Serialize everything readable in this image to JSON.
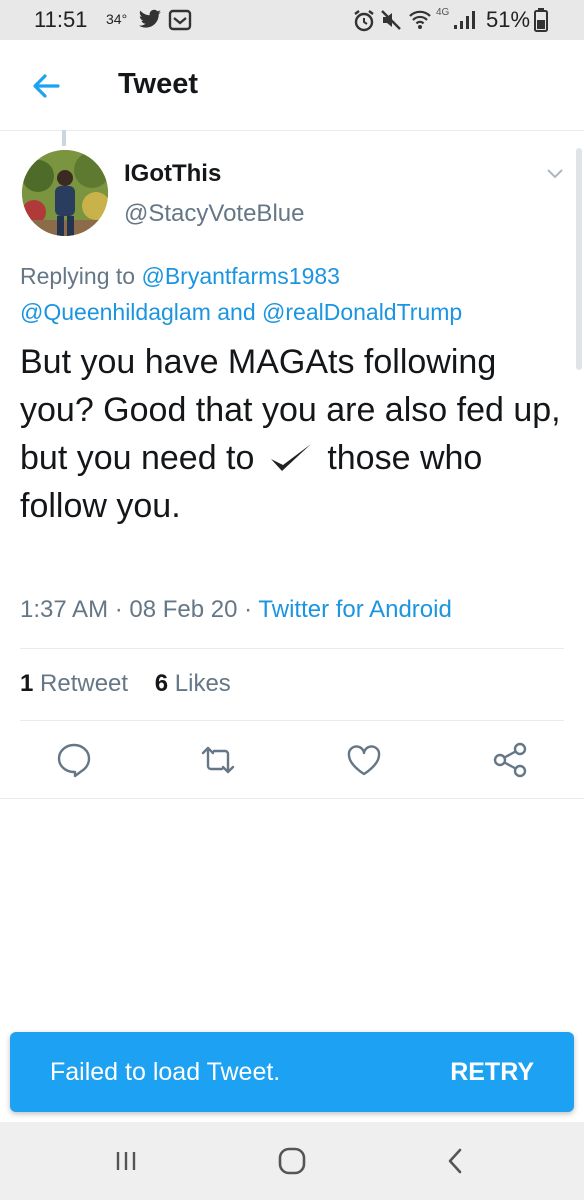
{
  "status_bar": {
    "time": "11:51",
    "temperature": "34°",
    "network": "4G",
    "battery_percent": "51%",
    "icons": [
      "twitter-icon",
      "image-icon",
      "alarm-icon",
      "mute-icon",
      "wifi-icon",
      "signal-icon",
      "battery-icon"
    ]
  },
  "app_bar": {
    "title": "Tweet",
    "back_icon": "arrow-left-icon"
  },
  "tweet": {
    "display_name": "IGotThis",
    "handle": "@StacyVoteBlue",
    "replying_prefix": "Replying to",
    "reply_to": [
      "@Bryantfarms1983",
      "@Queenhildaglam",
      "@realDonaldTrump"
    ],
    "reply_joiner": "and",
    "text_before_check": "But you have MAGAts following you? Good that you are also fed up, but you need to",
    "text_after_check": "those who follow you.",
    "time": "1:37 AM",
    "date": "08 Feb 20",
    "separator": "·",
    "source": "Twitter for Android",
    "retweets_count": "1",
    "retweets_label": "Retweet",
    "likes_count": "6",
    "likes_label": "Likes"
  },
  "actions": [
    "reply-icon",
    "retweet-icon",
    "like-icon",
    "share-icon"
  ],
  "toast": {
    "message": "Failed to load Tweet.",
    "action": "RETRY"
  },
  "navbar": {
    "icons": [
      "recent-apps-icon",
      "home-icon",
      "back-icon"
    ]
  },
  "colors": {
    "accent": "#1da1f2",
    "link": "#1b95e0",
    "secondary_text": "#657786",
    "border": "#e6ecf0"
  }
}
